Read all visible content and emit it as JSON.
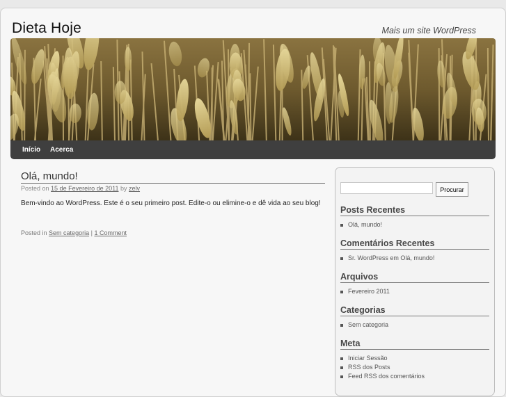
{
  "site": {
    "title": "Dieta Hoje",
    "description": "Mais um site WordPress"
  },
  "nav": {
    "items": [
      {
        "label": "Início"
      },
      {
        "label": "Acerca"
      }
    ]
  },
  "post": {
    "title": "Olá, mundo!",
    "posted_on_prefix": "Posted on",
    "date": "15 de Fevereiro de 2011",
    "by": "by",
    "author": "zelv",
    "body": "Bem-vindo ao WordPress. Este é o seu primeiro post. Edite-o ou elimine-o e dê vida ao seu blog!",
    "posted_in_prefix": "Posted in",
    "category": "Sem categoria",
    "separator": "|",
    "comments": "1 Comment"
  },
  "sidebar": {
    "search": {
      "button_label": "Procurar",
      "value": ""
    },
    "recent_posts": {
      "title": "Posts Recentes",
      "items": [
        "Olá, mundo!"
      ]
    },
    "recent_comments": {
      "title": "Comentários Recentes",
      "author": "Sr. WordPress",
      "em": "em",
      "post": "Olá, mundo!"
    },
    "archives": {
      "title": "Arquivos",
      "items": [
        "Fevereiro 2011"
      ]
    },
    "categories": {
      "title": "Categorias",
      "items": [
        "Sem categoria"
      ]
    },
    "meta": {
      "title": "Meta",
      "items": [
        "Iniciar Sessão",
        "RSS dos Posts",
        "Feed RSS dos comentários"
      ]
    }
  }
}
